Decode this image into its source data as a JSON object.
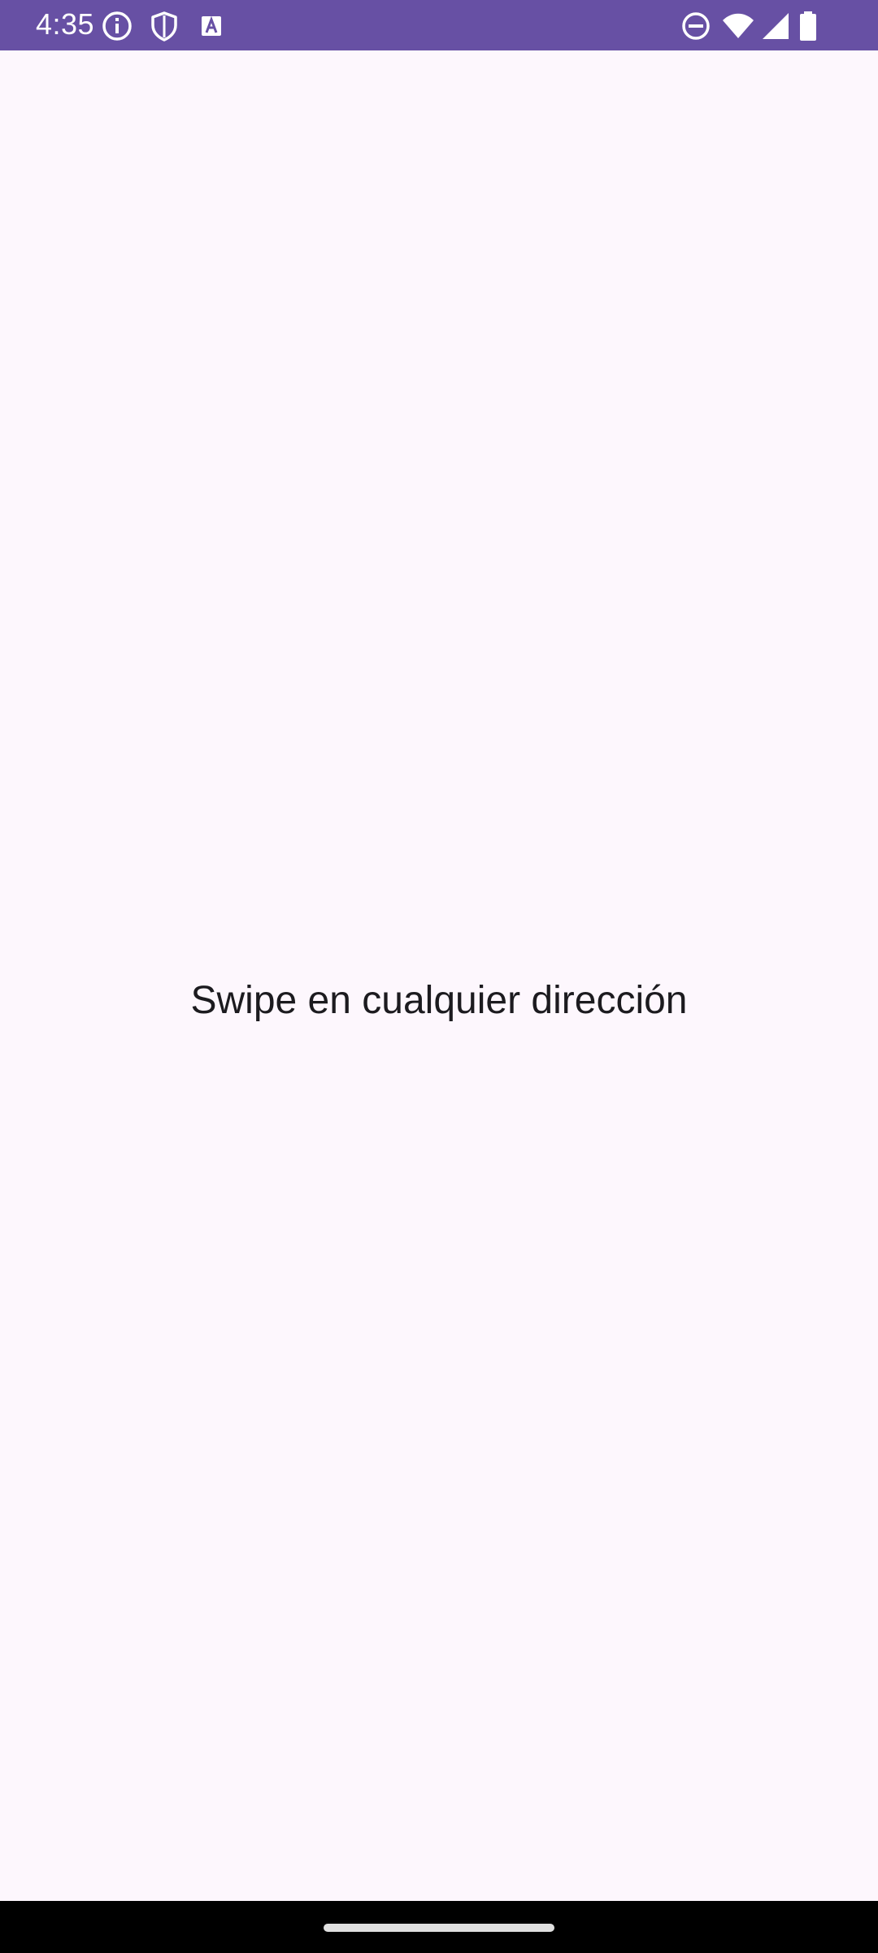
{
  "status_bar": {
    "time": "4:35",
    "background_color": "#6750A4",
    "left_icons": [
      "info-icon",
      "shield-icon",
      "font-icon"
    ],
    "right_icons": [
      "do-not-disturb-icon",
      "wifi-icon",
      "signal-icon",
      "battery-icon"
    ]
  },
  "main": {
    "message": "Swipe en cualquier dirección",
    "background_color": "#FDF7FD"
  },
  "nav_bar": {
    "type": "gesture",
    "background_color": "#000000"
  }
}
